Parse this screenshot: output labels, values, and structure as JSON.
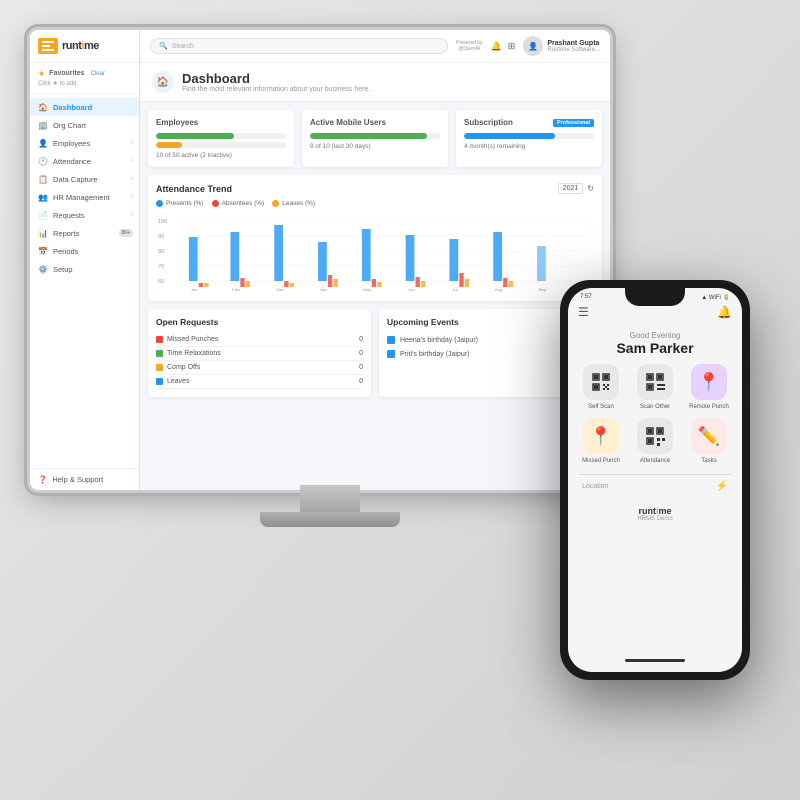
{
  "app": {
    "name": "runtime",
    "logo_text": "runt",
    "logo_highlight": "me"
  },
  "topbar": {
    "search_placeholder": "Search",
    "powered_by": "Powered by",
    "powered_brand": "@OpenAI",
    "user_name": "Prashant Gupta",
    "user_role": "Runtime Software..."
  },
  "sidebar": {
    "favourites_label": "Favourites",
    "favourites_clear": "Clear",
    "click_to_add": "Click ★ to add",
    "nav_items": [
      {
        "id": "dashboard",
        "label": "Dashboard",
        "icon": "🏠",
        "active": true
      },
      {
        "id": "org-chart",
        "label": "Org Chart",
        "icon": "🏢"
      },
      {
        "id": "employees",
        "label": "Employees",
        "icon": "👤",
        "has_arrow": true
      },
      {
        "id": "attendance",
        "label": "Attendance",
        "icon": "🕐",
        "has_arrow": true
      },
      {
        "id": "data-capture",
        "label": "Data Capture",
        "icon": "📋",
        "has_arrow": true
      },
      {
        "id": "hr-management",
        "label": "HR Management",
        "icon": "👥",
        "has_arrow": true
      },
      {
        "id": "requests",
        "label": "Requests",
        "icon": "📄",
        "has_arrow": true
      },
      {
        "id": "reports",
        "label": "Reports",
        "icon": "📊",
        "badge": "30+"
      },
      {
        "id": "periods",
        "label": "Periods",
        "icon": "📅"
      },
      {
        "id": "setup",
        "label": "Setup",
        "icon": "⚙️"
      }
    ],
    "help_label": "Help & Support"
  },
  "page": {
    "title": "Dashboard",
    "subtitle": "Find the most relevant information about your business here."
  },
  "stats": {
    "employees": {
      "title": "Employees",
      "bar1_color": "#4CAF50",
      "bar1_pct": 60,
      "bar2_color": "#f5a623",
      "bar2_pct": 20,
      "description": "10 of 50 active (2 inactive)"
    },
    "mobile_users": {
      "title": "Active Mobile Users",
      "bar1_color": "#4CAF50",
      "bar1_pct": 90,
      "description": "9 of 10 (last 30 days)"
    },
    "subscription": {
      "title": "Subscription",
      "badge": "Professional",
      "bar1_color": "#2196F3",
      "bar1_pct": 70,
      "description": "4 month(s) remaining"
    }
  },
  "chart": {
    "title": "Attendance Trend",
    "year": "2021",
    "legend": [
      {
        "label": "Presents (%)",
        "color": "#2196F3"
      },
      {
        "label": "Absentees (%)",
        "color": "#f44336"
      },
      {
        "label": "Leaves (%)",
        "color": "#f5a623"
      }
    ],
    "months": [
      "Jan",
      "Feb",
      "Mar",
      "Apr",
      "May",
      "Jun",
      "Jul",
      "Aug",
      "Sep"
    ],
    "bars": [
      {
        "month": "Jan",
        "present": 80,
        "absent": 5,
        "leave": 5
      },
      {
        "month": "Feb",
        "present": 85,
        "absent": 8,
        "leave": 4
      },
      {
        "month": "Mar",
        "present": 90,
        "absent": 6,
        "leave": 3
      },
      {
        "month": "Apr",
        "present": 75,
        "absent": 10,
        "leave": 6
      },
      {
        "month": "May",
        "present": 88,
        "absent": 7,
        "leave": 4
      },
      {
        "month": "Jun",
        "present": 82,
        "absent": 9,
        "leave": 5
      },
      {
        "month": "Jul",
        "present": 79,
        "absent": 11,
        "leave": 6
      },
      {
        "month": "Aug",
        "present": 85,
        "absent": 8,
        "leave": 5
      },
      {
        "month": "Sep",
        "present": 70,
        "absent": 12,
        "leave": 7
      }
    ]
  },
  "open_requests": {
    "title": "Open Requests",
    "items": [
      {
        "label": "Missed Punches",
        "color": "#f44336",
        "count": 0
      },
      {
        "label": "Time Relaxations",
        "color": "#4CAF50",
        "count": 0
      },
      {
        "label": "Comp Offs",
        "color": "#f5a623",
        "count": 0
      },
      {
        "label": "Leaves",
        "color": "#2196F3",
        "count": 0
      }
    ]
  },
  "upcoming_events": {
    "title": "Upcoming Events",
    "items": [
      {
        "label": "Heena's birthday (Jaipur)",
        "color": "#2196F3"
      },
      {
        "label": "Priti's birthday (Jaipur)",
        "color": "#2196F3"
      }
    ]
  },
  "phone": {
    "time": "7:57",
    "greeting": "Good Evening",
    "user_name": "Sam Parker",
    "actions": [
      {
        "label": "Self Scan",
        "icon_class": "action-qr"
      },
      {
        "label": "Scan Other",
        "icon_class": "action-scan"
      },
      {
        "label": "Remote Punch",
        "icon_class": "action-remote"
      },
      {
        "label": "Missed Punch",
        "icon_class": "action-missed"
      },
      {
        "label": "Attendance",
        "icon_class": "action-attendance"
      },
      {
        "label": "Tasks",
        "icon_class": "action-tasks"
      }
    ],
    "location_label": "Location",
    "brand": "runtime",
    "brand_sub": "HRMS Demo"
  }
}
